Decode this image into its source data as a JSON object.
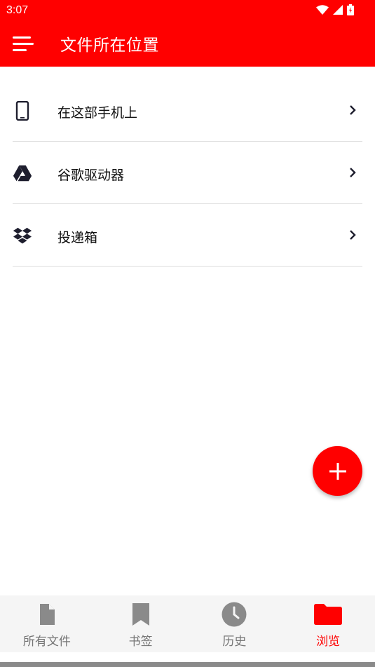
{
  "status_bar": {
    "time": "3:07",
    "icons": [
      "wifi-icon",
      "signal-icon",
      "battery-icon"
    ]
  },
  "app_bar": {
    "title": "文件所在位置",
    "menu_icon": "menu-icon"
  },
  "locations": [
    {
      "label": "在这部手机上",
      "icon": "phone-icon"
    },
    {
      "label": "谷歌驱动器",
      "icon": "google-drive-icon"
    },
    {
      "label": "投递箱",
      "icon": "dropbox-icon"
    }
  ],
  "fab": {
    "icon": "plus-icon"
  },
  "bottom_nav": {
    "items": [
      {
        "label": "所有文件",
        "icon": "file-icon"
      },
      {
        "label": "书签",
        "icon": "bookmark-icon"
      },
      {
        "label": "历史",
        "icon": "clock-icon"
      },
      {
        "label": "浏览",
        "icon": "folder-icon"
      }
    ],
    "active_index": 3
  },
  "colors": {
    "accent": "#ff0000",
    "inactive": "#757575",
    "icon_dark": "#1e1e2e"
  }
}
